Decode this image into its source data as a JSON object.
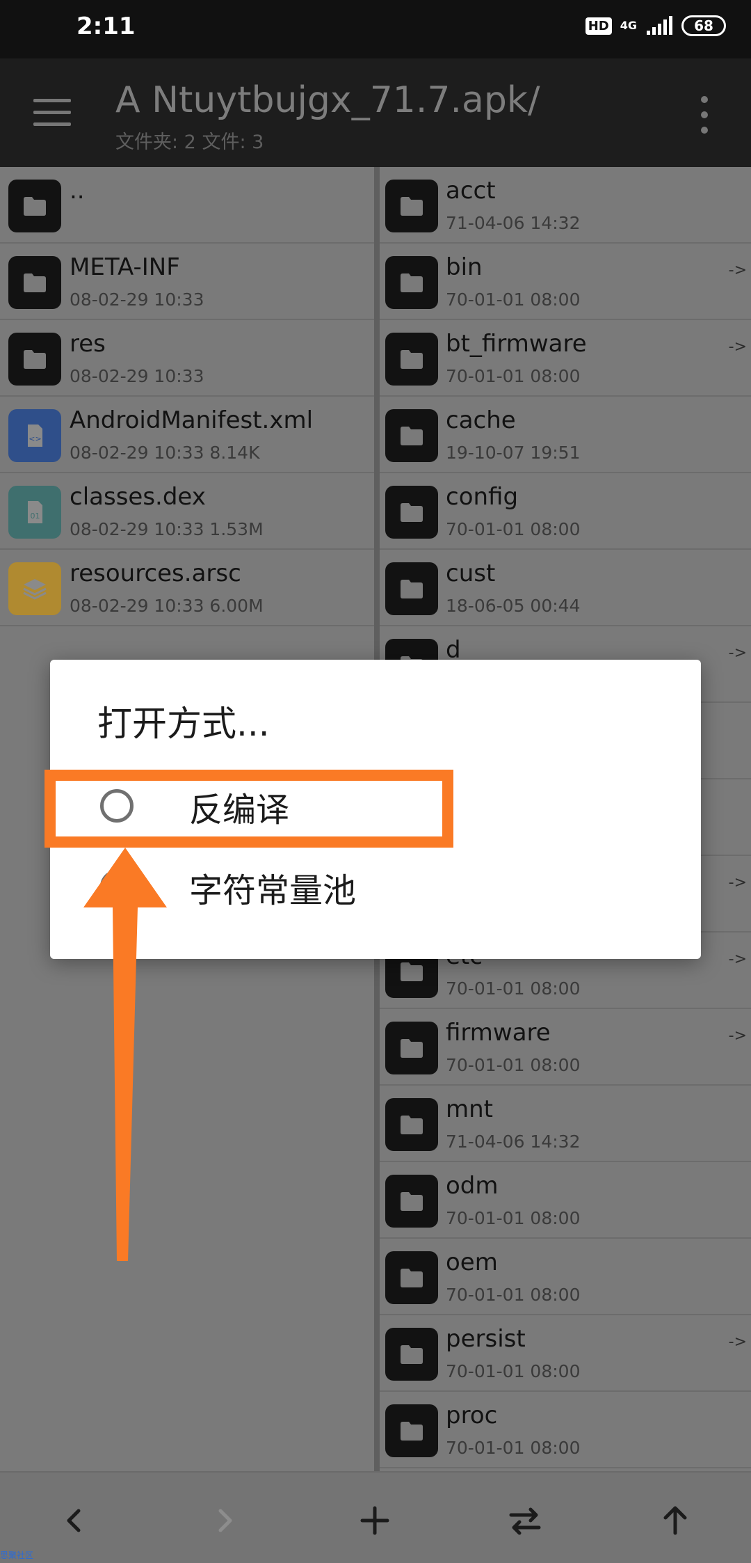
{
  "status_bar": {
    "time": "2:11",
    "hd": "HD",
    "network": "4G",
    "battery": "68"
  },
  "app_bar": {
    "title": "A Ntuytbujgx_71.7.apk/",
    "subtitle": "文件夹: 2  文件: 3",
    "menu_icon": "hamburger-menu-icon",
    "more_icon": "more-vertical-icon"
  },
  "left_pane": {
    "items": [
      {
        "name": "..",
        "meta": "",
        "icon": "folder"
      },
      {
        "name": "META-INF",
        "meta": "08-02-29 10:33",
        "icon": "folder"
      },
      {
        "name": "res",
        "meta": "08-02-29 10:33",
        "icon": "folder"
      },
      {
        "name": "AndroidManifest.xml",
        "meta": "08-02-29 10:33  8.14K",
        "icon": "xml"
      },
      {
        "name": "classes.dex",
        "meta": "08-02-29 10:33  1.53M",
        "icon": "dex"
      },
      {
        "name": "resources.arsc",
        "meta": "08-02-29 10:33  6.00M",
        "icon": "layers"
      }
    ]
  },
  "right_pane": {
    "items": [
      {
        "name": "acct",
        "meta": "71-04-06 14:32",
        "link": ""
      },
      {
        "name": "bin",
        "meta": "70-01-01 08:00",
        "link": "->"
      },
      {
        "name": "bt_firmware",
        "meta": "70-01-01 08:00",
        "link": "->"
      },
      {
        "name": "cache",
        "meta": "19-10-07 19:51",
        "link": ""
      },
      {
        "name": "config",
        "meta": "70-01-01 08:00",
        "link": ""
      },
      {
        "name": "cust",
        "meta": "18-06-05 00:44",
        "link": ""
      },
      {
        "name": "d",
        "meta": "",
        "link": "->"
      },
      {
        "name": "",
        "meta": "",
        "link": ""
      },
      {
        "name": "",
        "meta": "",
        "link": ""
      },
      {
        "name": "",
        "meta": "",
        "link": "->"
      },
      {
        "name": "etc",
        "meta": "70-01-01 08:00",
        "link": "->"
      },
      {
        "name": "firmware",
        "meta": "70-01-01 08:00",
        "link": "->"
      },
      {
        "name": "mnt",
        "meta": "71-04-06 14:32",
        "link": ""
      },
      {
        "name": "odm",
        "meta": "70-01-01 08:00",
        "link": ""
      },
      {
        "name": "oem",
        "meta": "70-01-01 08:00",
        "link": ""
      },
      {
        "name": "persist",
        "meta": "70-01-01 08:00",
        "link": "->"
      },
      {
        "name": "proc",
        "meta": "70-01-01 08:00",
        "link": ""
      }
    ]
  },
  "dialog": {
    "title": "打开方式...",
    "options": [
      {
        "label": "反编译",
        "selected": false
      },
      {
        "label": "字符常量池",
        "selected": false
      }
    ]
  },
  "annotation": {
    "highlight_color": "#fa7a25"
  },
  "bottom_bar": {
    "buttons": [
      "back-icon",
      "forward-icon",
      "add-icon",
      "swap-icon",
      "up-icon"
    ]
  },
  "watermark": "思聚社区"
}
